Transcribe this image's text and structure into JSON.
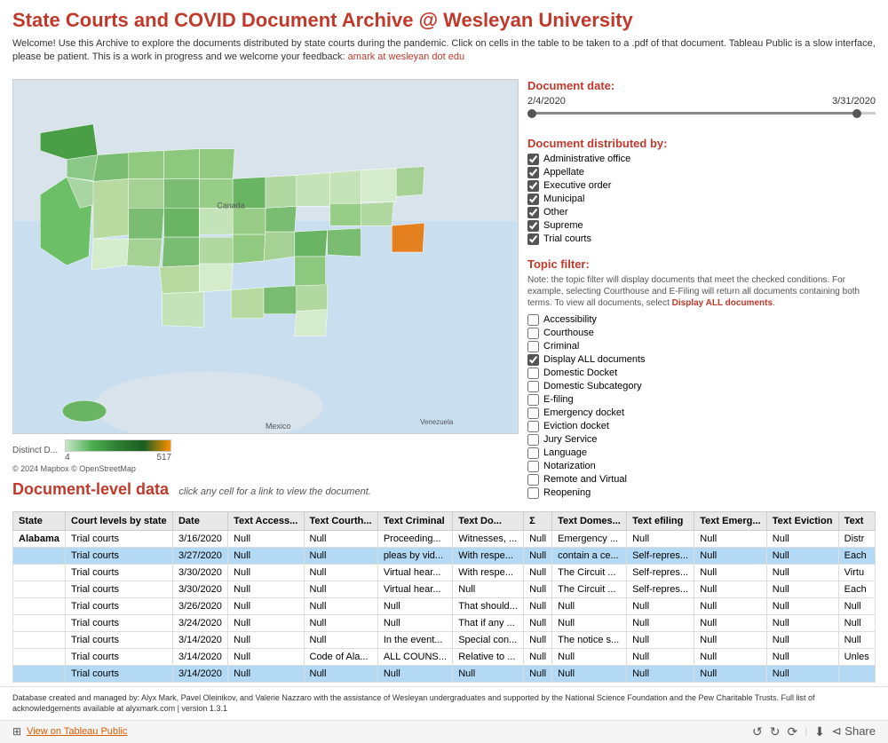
{
  "header": {
    "title": "State Courts and COVID Document Archive @ Wesleyan University",
    "description": "Welcome! Use this Archive to explore the documents distributed by state courts during the pandemic. Click on cells in the table to be taken to a .pdf of that document. Tableau Public is a slow interface, please be patient.  This is a work in progress and we welcome your feedback:",
    "email": "amark at wesleyan dot edu"
  },
  "date_filter": {
    "label": "Document date:",
    "start": "2/4/2020",
    "end": "3/31/2020"
  },
  "distributed_by": {
    "label": "Document distributed by:",
    "items": [
      {
        "label": "Administrative office",
        "checked": true
      },
      {
        "label": "Appellate",
        "checked": true
      },
      {
        "label": "Executive order",
        "checked": true
      },
      {
        "label": "Municipal",
        "checked": true
      },
      {
        "label": "Other",
        "checked": true
      },
      {
        "label": "Supreme",
        "checked": true
      },
      {
        "label": "Trial courts",
        "checked": true
      }
    ]
  },
  "topic_filter": {
    "label": "Topic filter:",
    "note": "Note: the topic filter will display documents that meet the checked conditions. For example, selecting Courthouse and E-Filing will return all documents containing both terms. To view all documents, select",
    "display_all_label": "Display ALL documents",
    "note_end": ".",
    "items": [
      {
        "label": "Accessibility",
        "checked": false
      },
      {
        "label": "Courthouse",
        "checked": false
      },
      {
        "label": "Criminal",
        "checked": false
      },
      {
        "label": "Display ALL documents",
        "checked": true
      },
      {
        "label": "Domestic Docket",
        "checked": false
      },
      {
        "label": "Domestic Subcategory",
        "checked": false
      },
      {
        "label": "E-filing",
        "checked": false
      },
      {
        "label": "Emergency docket",
        "checked": false
      },
      {
        "label": "Eviction docket",
        "checked": false
      },
      {
        "label": "Jury Service",
        "checked": false
      },
      {
        "label": "Language",
        "checked": false
      },
      {
        "label": "Notarization",
        "checked": false
      },
      {
        "label": "Remote and Virtual",
        "checked": false
      },
      {
        "label": "Reopening",
        "checked": false
      }
    ]
  },
  "map": {
    "credit": "© 2024 Mapbox  © OpenStreetMap",
    "legend_label": "Distinct D...",
    "legend_min": "4",
    "legend_max": "517"
  },
  "doc_level": {
    "title": "Document-level data",
    "subtitle": "click any cell for a link to view the document."
  },
  "table": {
    "columns": [
      "State",
      "Court levels by state",
      "Date",
      "Text Access...",
      "Text Courth...",
      "Text Criminal",
      "Text Do...",
      "Σ",
      "Text Domes...",
      "Text efiling",
      "Text Emerg...",
      "Text Eviction",
      "Text"
    ],
    "rows": [
      {
        "state": "Alabama",
        "court": "Trial courts",
        "date": "3/16/2020",
        "access": "Null",
        "courth": "Null",
        "criminal": "Proceeding...",
        "do": "Witnesses, ...",
        "sigma": "Null",
        "domes": "Emergency ...",
        "efiling": "Null",
        "emerg": "Null",
        "eviction": "Null",
        "text": "Distr"
      },
      {
        "state": "",
        "court": "Trial courts",
        "date": "3/27/2020",
        "access": "Null",
        "courth": "Null",
        "criminal": "pleas by vid...",
        "do": "With respe...",
        "sigma": "Null",
        "domes": "contain a ce...",
        "efiling": "Self-repres...",
        "emerg": "Null",
        "eviction": "Null",
        "text": "Each"
      },
      {
        "state": "",
        "court": "Trial courts",
        "date": "3/30/2020",
        "access": "Null",
        "courth": "Null",
        "criminal": "Virtual hear...",
        "do": "With respe...",
        "sigma": "Null",
        "domes": "The Circuit ...",
        "efiling": "Self-repres...",
        "emerg": "Null",
        "eviction": "Null",
        "text": "Virtu"
      },
      {
        "state": "",
        "court": "Trial courts",
        "date": "3/30/2020",
        "access": "Null",
        "courth": "Null",
        "criminal": "Virtual hear...",
        "do": "Null",
        "sigma": "Null",
        "domes": "The Circuit ...",
        "efiling": "Self-repres...",
        "emerg": "Null",
        "eviction": "Null",
        "text": "Each"
      },
      {
        "state": "",
        "court": "Trial courts",
        "date": "3/26/2020",
        "access": "Null",
        "courth": "Null",
        "criminal": "Null",
        "do": "That should...",
        "sigma": "Null",
        "domes": "Null",
        "efiling": "Null",
        "emerg": "Null",
        "eviction": "Null",
        "text": "Null"
      },
      {
        "state": "",
        "court": "Trial courts",
        "date": "3/24/2020",
        "access": "Null",
        "courth": "Null",
        "criminal": "Null",
        "do": "That if any ...",
        "sigma": "Null",
        "domes": "Null",
        "efiling": "Null",
        "emerg": "Null",
        "eviction": "Null",
        "text": "Null"
      },
      {
        "state": "",
        "court": "Trial courts",
        "date": "3/14/2020",
        "access": "Null",
        "courth": "Null",
        "criminal": "In the event...",
        "do": "Special con...",
        "sigma": "Null",
        "domes": "The notice s...",
        "efiling": "Null",
        "emerg": "Null",
        "eviction": "Null",
        "text": "Null"
      },
      {
        "state": "",
        "court": "Trial courts",
        "date": "3/14/2020",
        "access": "Null",
        "courth": "Code of Ala...",
        "criminal": "ALL COUNS...",
        "do": "Relative to ...",
        "sigma": "Null",
        "domes": "Null",
        "efiling": "Null",
        "emerg": "Null",
        "eviction": "Null",
        "text": "Unles"
      },
      {
        "state": "",
        "court": "Trial courts",
        "date": "3/14/2020",
        "access": "Null",
        "courth": "Null",
        "criminal": "Null",
        "do": "Null",
        "sigma": "Null",
        "domes": "Null",
        "efiling": "Null",
        "emerg": "Null",
        "eviction": "Null",
        "text": ""
      }
    ]
  },
  "footer": {
    "text": "Database created and managed by: Alyx Mark, Pavel Oleinikov, and Valerie Nazzaro with the assistance of Wesleyan undergraduates and supported by the National Science Foundation and the Pew Charitable Trusts. Full list of acknowledgements available at alyxmark.com | version 1.3.1"
  },
  "bottom_bar": {
    "view_label": "View on Tableau Public",
    "icons": [
      "undo",
      "redo",
      "reset",
      "download",
      "share"
    ]
  }
}
